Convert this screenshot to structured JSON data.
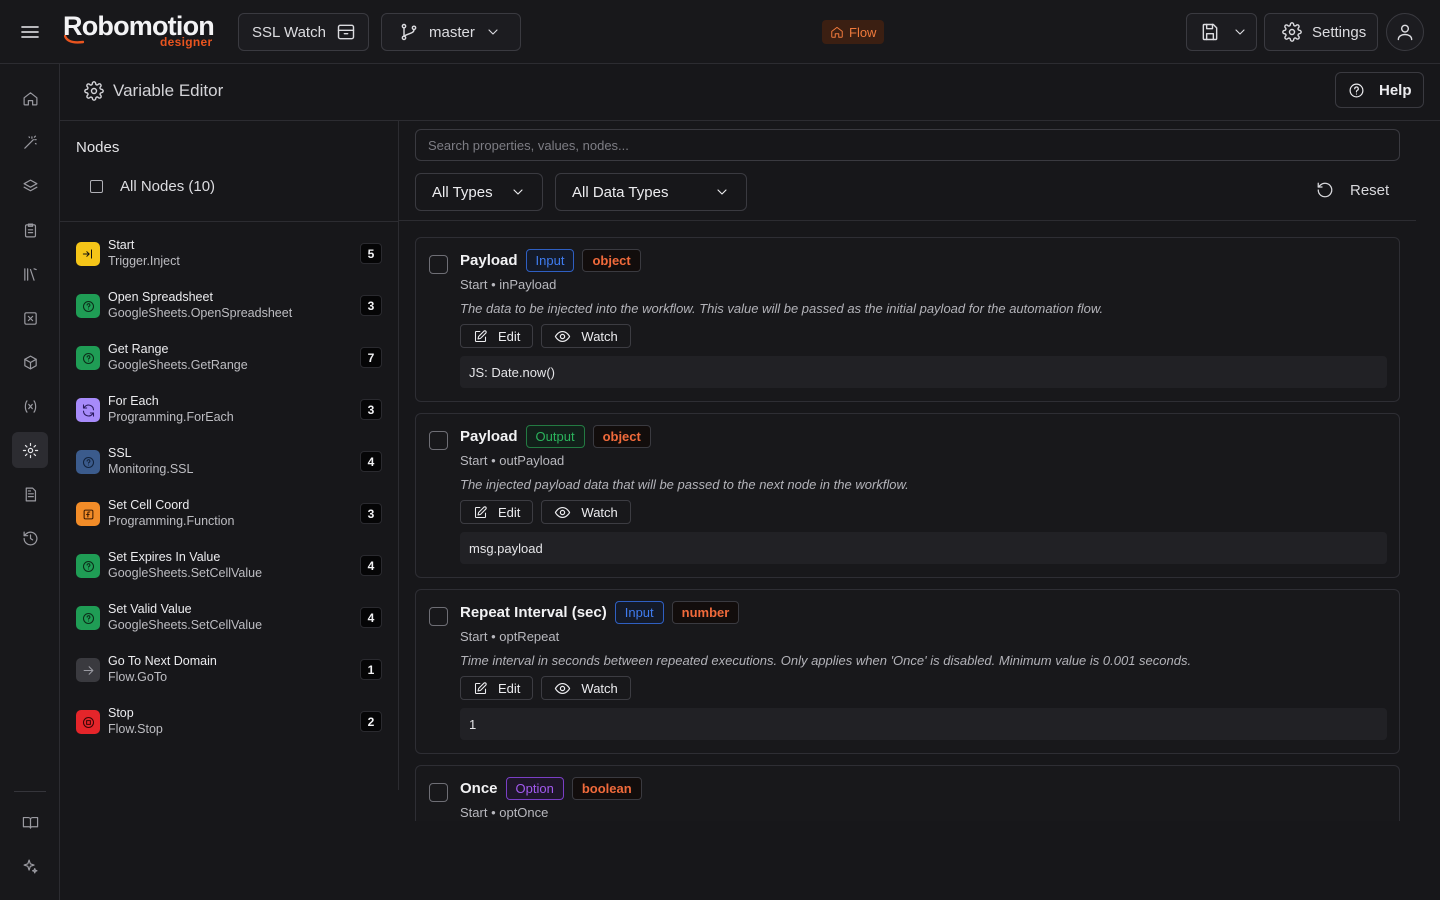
{
  "app": {
    "logo_main": "Robomotion",
    "logo_sub": "designer",
    "project_name": "SSL Watch",
    "branch": "master",
    "flow_badge": "Flow",
    "settings_label": "Settings"
  },
  "page": {
    "title": "Variable Editor",
    "help_label": "Help"
  },
  "nodes_panel": {
    "title": "Nodes",
    "all_nodes_label": "All Nodes (10)",
    "nodes": [
      {
        "name": "Start",
        "type": "Trigger.Inject",
        "count": "5",
        "icon": "inject-icon",
        "color": "#f5c518"
      },
      {
        "name": "Open Spreadsheet",
        "type": "GoogleSheets.OpenSpreadsheet",
        "count": "3",
        "icon": "sheets-icon",
        "color": "#1f9d55"
      },
      {
        "name": "Get Range",
        "type": "GoogleSheets.GetRange",
        "count": "7",
        "icon": "sheets-icon",
        "color": "#1f9d55"
      },
      {
        "name": "For Each",
        "type": "Programming.ForEach",
        "count": "3",
        "icon": "loop-icon",
        "color": "#a78bfa"
      },
      {
        "name": "SSL",
        "type": "Monitoring.SSL",
        "count": "4",
        "icon": "ssl-icon",
        "color": "#3b5b8c"
      },
      {
        "name": "Set Cell Coord",
        "type": "Programming.Function",
        "count": "3",
        "icon": "function-icon",
        "color": "#f28c28"
      },
      {
        "name": "Set Expires In Value",
        "type": "GoogleSheets.SetCellValue",
        "count": "4",
        "icon": "sheets-icon",
        "color": "#1f9d55"
      },
      {
        "name": "Set Valid Value",
        "type": "GoogleSheets.SetCellValue",
        "count": "4",
        "icon": "sheets-icon",
        "color": "#1f9d55"
      },
      {
        "name": "Go To Next Domain",
        "type": "Flow.GoTo",
        "count": "1",
        "icon": "goto-icon",
        "color": "#3a3a3f"
      },
      {
        "name": "Stop",
        "type": "Flow.Stop",
        "count": "2",
        "icon": "stop-icon",
        "color": "#e5252a"
      }
    ]
  },
  "filters": {
    "search_placeholder": "Search properties, values, nodes...",
    "types_label": "All Types",
    "data_types_label": "All Data Types",
    "reset_label": "Reset"
  },
  "actions": {
    "edit_label": "Edit",
    "watch_label": "Watch"
  },
  "properties": [
    {
      "name": "Payload",
      "kind": "Input",
      "kind_style": "input",
      "data_type": "object",
      "path": "Start • inPayload",
      "description": "The data to be injected into the workflow. This value will be passed as the initial payload for the automation flow.",
      "value": "JS: Date.now()"
    },
    {
      "name": "Payload",
      "kind": "Output",
      "kind_style": "output",
      "data_type": "object",
      "path": "Start • outPayload",
      "description": "The injected payload data that will be passed to the next node in the workflow.",
      "value": "msg.payload"
    },
    {
      "name": "Repeat Interval (sec)",
      "kind": "Input",
      "kind_style": "input",
      "data_type": "number",
      "path": "Start • optRepeat",
      "description": "Time interval in seconds between repeated executions. Only applies when 'Once' is disabled. Minimum value is 0.001 seconds.",
      "value": "1"
    },
    {
      "name": "Once",
      "kind": "Option",
      "kind_style": "option",
      "data_type": "boolean",
      "path": "Start • optOnce",
      "description": "",
      "value": ""
    }
  ]
}
